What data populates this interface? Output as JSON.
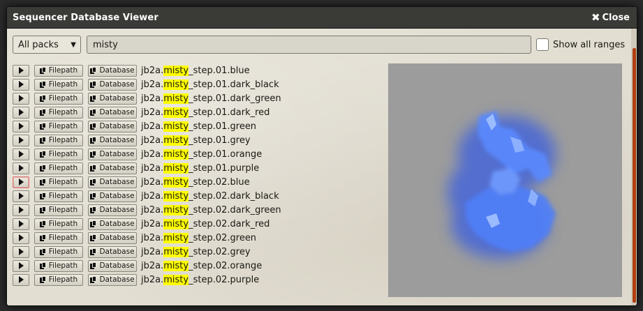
{
  "window": {
    "title": "Sequencer Database Viewer",
    "close_label": "Close"
  },
  "toolbar": {
    "pack_select_value": "All packs",
    "search_value": "misty",
    "show_all_ranges_label": "Show all ranges"
  },
  "buttons": {
    "filepath_label": "Filepath",
    "database_label": "Database"
  },
  "entries": [
    {
      "prefix": "jb2a.",
      "highlight": "misty",
      "suffix": "_step.01.blue"
    },
    {
      "prefix": "jb2a.",
      "highlight": "misty",
      "suffix": "_step.01.dark_black"
    },
    {
      "prefix": "jb2a.",
      "highlight": "misty",
      "suffix": "_step.01.dark_green"
    },
    {
      "prefix": "jb2a.",
      "highlight": "misty",
      "suffix": "_step.01.dark_red"
    },
    {
      "prefix": "jb2a.",
      "highlight": "misty",
      "suffix": "_step.01.green"
    },
    {
      "prefix": "jb2a.",
      "highlight": "misty",
      "suffix": "_step.01.grey"
    },
    {
      "prefix": "jb2a.",
      "highlight": "misty",
      "suffix": "_step.01.orange"
    },
    {
      "prefix": "jb2a.",
      "highlight": "misty",
      "suffix": "_step.01.purple"
    },
    {
      "prefix": "jb2a.",
      "highlight": "misty",
      "suffix": "_step.02.blue"
    },
    {
      "prefix": "jb2a.",
      "highlight": "misty",
      "suffix": "_step.02.dark_black"
    },
    {
      "prefix": "jb2a.",
      "highlight": "misty",
      "suffix": "_step.02.dark_green"
    },
    {
      "prefix": "jb2a.",
      "highlight": "misty",
      "suffix": "_step.02.dark_red"
    },
    {
      "prefix": "jb2a.",
      "highlight": "misty",
      "suffix": "_step.02.green"
    },
    {
      "prefix": "jb2a.",
      "highlight": "misty",
      "suffix": "_step.02.grey"
    },
    {
      "prefix": "jb2a.",
      "highlight": "misty",
      "suffix": "_step.02.orange"
    },
    {
      "prefix": "jb2a.",
      "highlight": "misty",
      "suffix": "_step.02.purple"
    }
  ],
  "active_row_index": 8,
  "icons": {
    "play": "play-icon",
    "copy": "copy-icon",
    "close": "close-icon"
  },
  "colors": {
    "highlight": "#ffff00",
    "preview_background": "#9c9c9c",
    "effect": "#4a7cff",
    "scrollbar_thumb": "#b04010"
  }
}
